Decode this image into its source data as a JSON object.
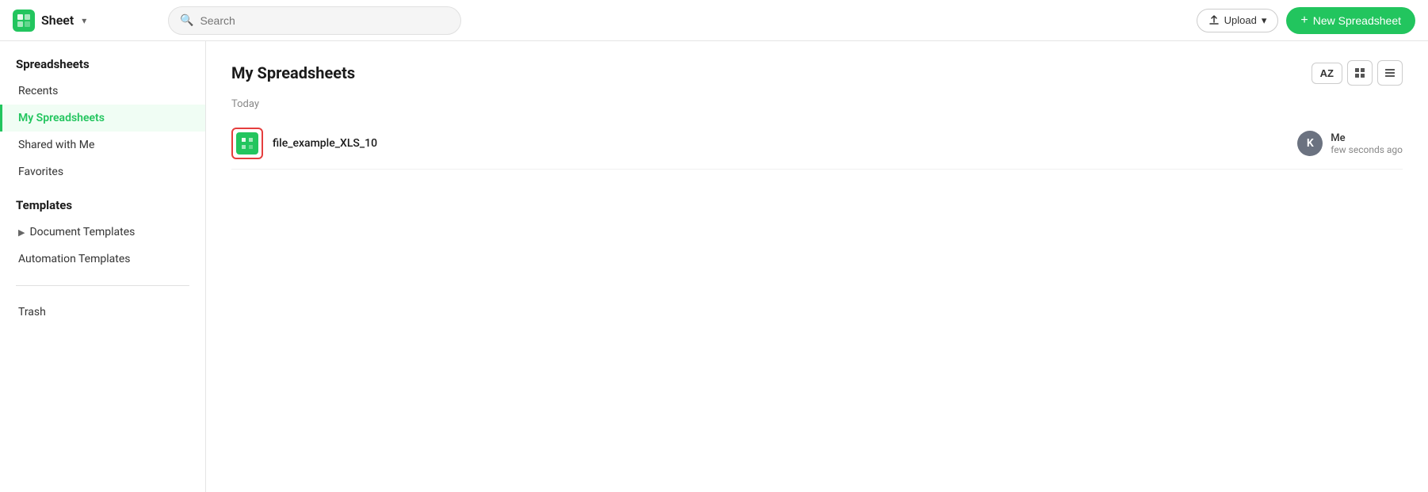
{
  "topbar": {
    "app_name": "Sheet",
    "chevron": "▾",
    "search_placeholder": "Search",
    "upload_label": "Upload",
    "new_spreadsheet_label": "New Spreadsheet"
  },
  "sidebar": {
    "section_spreadsheets": "Spreadsheets",
    "section_templates": "Templates",
    "items_spreadsheets": [
      {
        "id": "recents",
        "label": "Recents",
        "active": false
      },
      {
        "id": "my-spreadsheets",
        "label": "My Spreadsheets",
        "active": true
      },
      {
        "id": "shared-with-me",
        "label": "Shared with Me",
        "active": false
      },
      {
        "id": "favorites",
        "label": "Favorites",
        "active": false
      }
    ],
    "items_templates": [
      {
        "id": "document-templates",
        "label": "Document Templates",
        "hasChevron": true,
        "active": false
      },
      {
        "id": "automation-templates",
        "label": "Automation Templates",
        "active": false
      }
    ],
    "trash_label": "Trash"
  },
  "content": {
    "title": "My Spreadsheets",
    "date_group": "Today",
    "sort_label": "AZ",
    "files": [
      {
        "id": "file-1",
        "name": "file_example_XLS_10",
        "owner_initial": "K",
        "owner_name": "Me",
        "modified": "few seconds ago"
      }
    ]
  }
}
